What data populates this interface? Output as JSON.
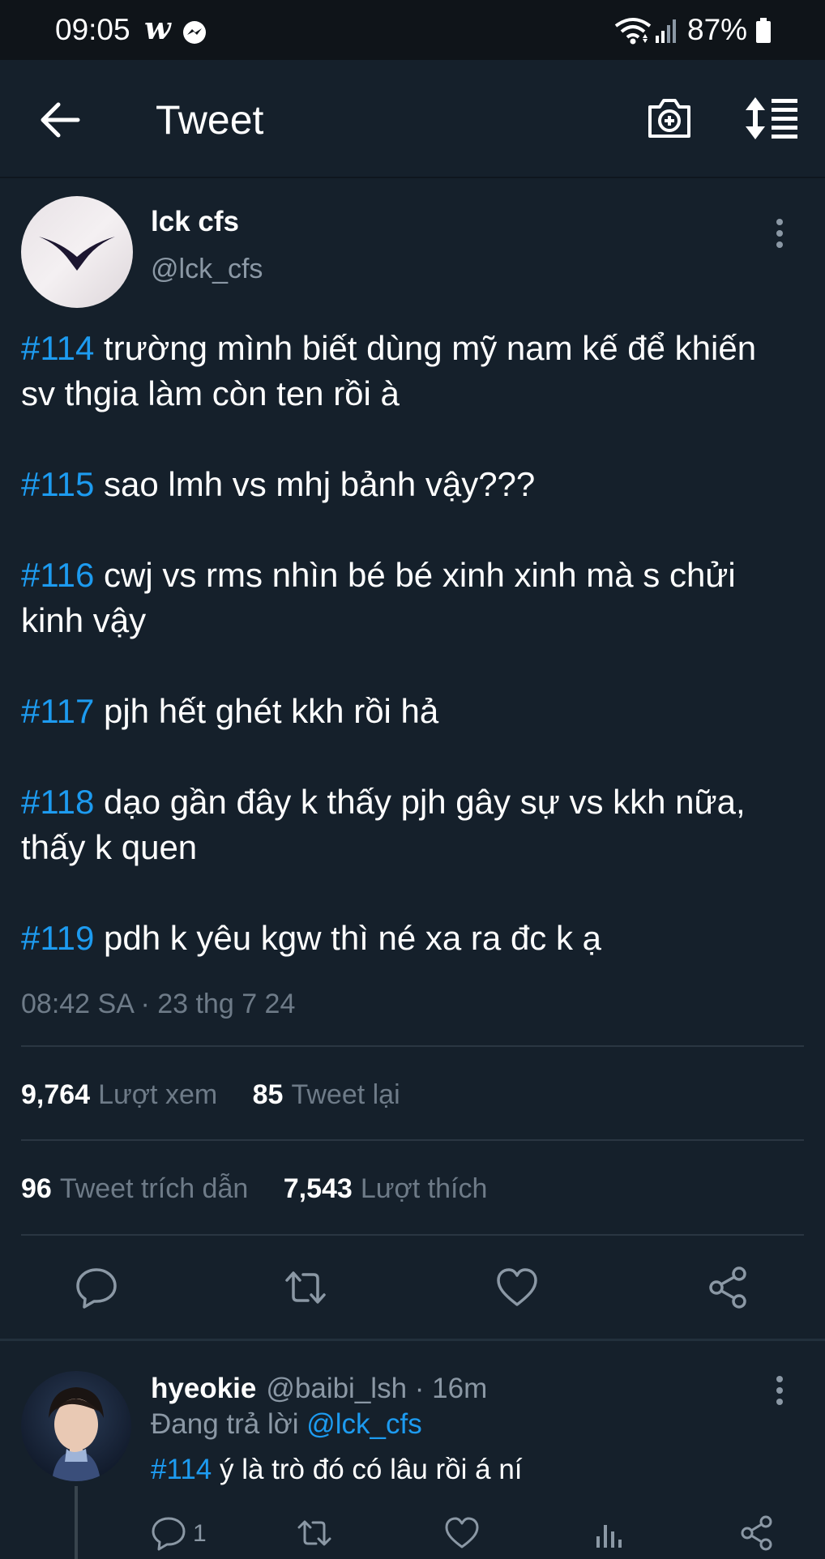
{
  "status_bar": {
    "time": "09:05",
    "app_icon_letter": "w",
    "battery": "87%"
  },
  "header": {
    "title": "Tweet"
  },
  "tweet": {
    "author_name": "lck cfs",
    "author_handle": "@lck_cfs",
    "paragraphs": [
      {
        "tag": "#114",
        "text": " trường mình biết dùng mỹ nam kế để khiến sv thgia làm còn ten rồi à"
      },
      {
        "tag": "#115",
        "text": " sao lmh vs mhj bảnh vậy???"
      },
      {
        "tag": "#116",
        "text": " cwj vs rms nhìn bé bé xinh xinh mà s chửi kinh vậy"
      },
      {
        "tag": "#117",
        "text": " pjh hết ghét kkh rồi hả"
      },
      {
        "tag": "#118",
        "text": " dạo gần đây k thấy pjh gây sự vs kkh nữa, thấy k quen"
      },
      {
        "tag": "#119",
        "text": " pdh k yêu kgw thì né xa ra đc k ạ"
      }
    ],
    "timestamp": "08:42 SA · 23 thg 7 24",
    "stats": {
      "views_count": "9,764",
      "views_label": "Lượt xem",
      "retweets_count": "85",
      "retweets_label": "Tweet lại",
      "quotes_count": "96",
      "quotes_label": "Tweet trích dẫn",
      "likes_count": "7,543",
      "likes_label": "Lượt thích"
    }
  },
  "reply": {
    "name": "hyeokie",
    "handle_time": "@baibi_lsh · 16m",
    "context_prefix": "Đang trả lời ",
    "context_mention": "@lck_cfs",
    "tag": "#114",
    "text": " ý là trò đó có lâu rồi á ní",
    "reply_count": "1"
  },
  "colors": {
    "background": "#15202b",
    "accent": "#1d9bf0",
    "secondary_text": "#8b98a5",
    "divider": "#2a3642"
  },
  "icons": {
    "back": "arrow-left-icon",
    "camera": "camera-plus-icon",
    "sort": "sort-list-icon",
    "more": "vertical-dots-icon",
    "reply": "comment-icon",
    "retweet": "retweet-icon",
    "like": "heart-icon",
    "share": "share-icon",
    "analytics": "bar-chart-icon"
  }
}
